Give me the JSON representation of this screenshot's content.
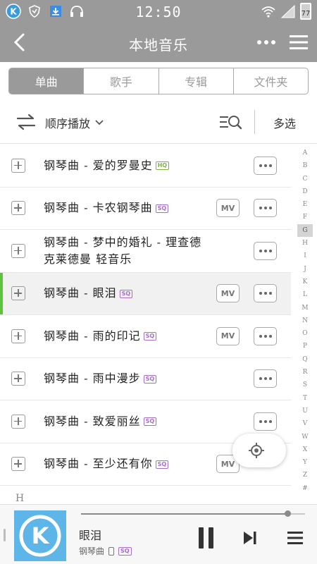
{
  "statusbar": {
    "time": "12:50",
    "battery": "77",
    "icons": [
      "kugou-app-icon",
      "shield-icon",
      "download-icon",
      "headphones-icon",
      "wifi-icon",
      "signal-icon",
      "battery-icon"
    ]
  },
  "header": {
    "title": "本地音乐",
    "back_icon": "back-arrow-icon",
    "more_icon": "more-dots-icon",
    "menu_icon": "hamburger-menu-icon"
  },
  "tabs": [
    {
      "label": "单曲",
      "active": true
    },
    {
      "label": "歌手",
      "active": false
    },
    {
      "label": "专辑",
      "active": false
    },
    {
      "label": "文件夹",
      "active": false
    }
  ],
  "toolbar": {
    "play_mode": "顺序播放",
    "multi_select": "多选"
  },
  "songs": [
    {
      "title": "钢琴曲 - 爱的罗曼史",
      "badge": "HQ",
      "mv": false
    },
    {
      "title": "钢琴曲 - 卡农钢琴曲",
      "badge": "SQ",
      "mv": true
    },
    {
      "title": "钢琴曲 - 梦中的婚礼 - 理查德克莱德曼 轻音乐",
      "badge": "",
      "mv": false
    },
    {
      "title": "钢琴曲 - 眼泪",
      "badge": "SQ",
      "mv": true,
      "playing": true
    },
    {
      "title": "钢琴曲 - 雨的印记",
      "badge": "SQ",
      "mv": true
    },
    {
      "title": "钢琴曲 - 雨中漫步",
      "badge": "SQ",
      "mv": false
    },
    {
      "title": "钢琴曲 - 致爱丽丝",
      "badge": "SQ",
      "mv": false
    },
    {
      "title": "钢琴曲 - 至少还有你",
      "badge": "SQ",
      "mv": true
    }
  ],
  "mv_label": "MV",
  "section_header": "H",
  "index_letters": [
    "A",
    "B",
    "C",
    "D",
    "E",
    "F",
    "G",
    "H",
    "I",
    "J",
    "K",
    "L",
    "M",
    "N",
    "O",
    "P",
    "Q",
    "R",
    "S",
    "T",
    "U",
    "V",
    "W",
    "X",
    "Y",
    "Z",
    "#"
  ],
  "index_active": "G",
  "player": {
    "title": "眼泪",
    "artist": "钢琴曲",
    "badge": "SQ",
    "progress": 0.92
  },
  "colors": {
    "header_bg": "#9a9a9a",
    "playing_bar": "#5fc23c",
    "hq": "#7cb342",
    "sq": "#a66ec9",
    "cover_bg": "#5eb6e8"
  }
}
